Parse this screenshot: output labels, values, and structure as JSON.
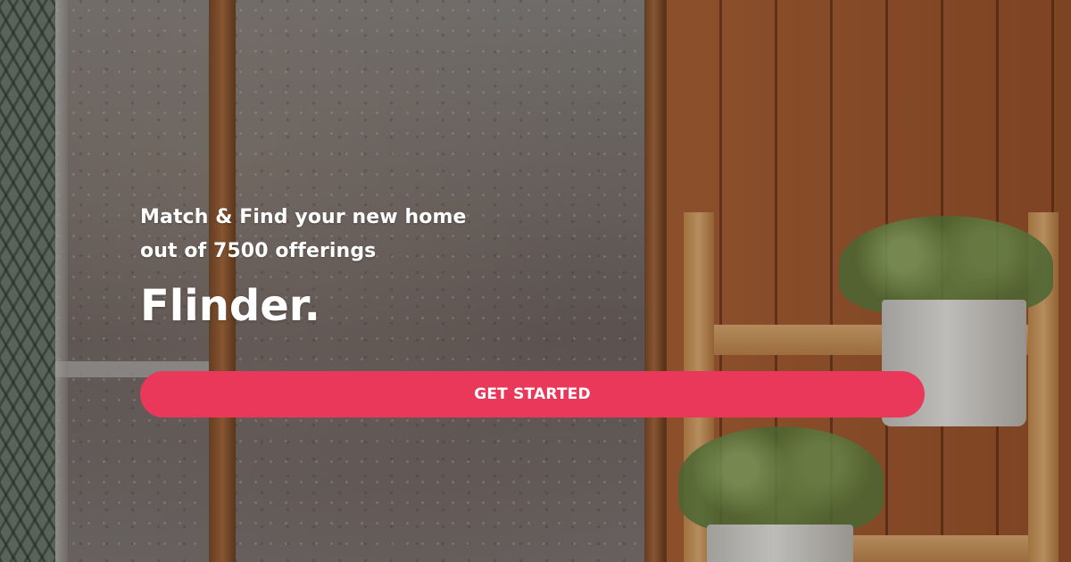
{
  "hero": {
    "tagline_line1": "Match & Find your new home",
    "tagline_line2": "out of 7500 offerings",
    "brand": "Flinder.",
    "cta_label": "GET STARTED"
  },
  "colors": {
    "accent": "#e9385a",
    "text": "#ffffff"
  }
}
